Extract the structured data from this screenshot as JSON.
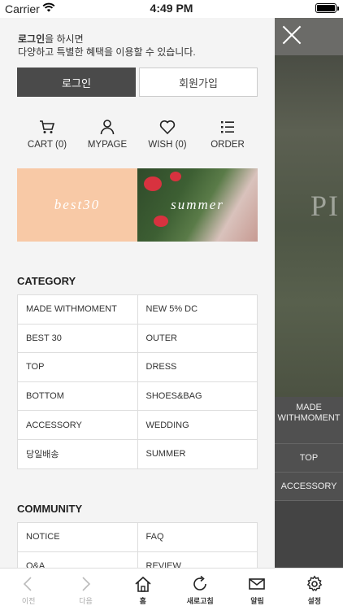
{
  "status_bar": {
    "carrier": "Carrier",
    "time": "4:49 PM"
  },
  "drawer": {
    "intro_bold": "로그인",
    "intro_rest": "을 하시면",
    "intro_line2": "다양하고 특별한 혜택을 이용할 수 있습니다.",
    "login_label": "로그인",
    "join_label": "회원가입",
    "quick_links": [
      {
        "label": "CART (0)",
        "icon": "cart-icon"
      },
      {
        "label": "MYPAGE",
        "icon": "person-icon"
      },
      {
        "label": "WISH (0)",
        "icon": "heart-icon"
      },
      {
        "label": "ORDER",
        "icon": "list-icon"
      }
    ],
    "banners": {
      "best": "best30",
      "summer": "summer"
    },
    "category_title": "CATEGORY",
    "categories": [
      "MADE WITHMOMENT",
      "NEW 5% DC",
      "BEST 30",
      "OUTER",
      "TOP",
      "DRESS",
      "BOTTOM",
      "SHOES&BAG",
      "ACCESSORY",
      "WEDDING",
      "당일배송",
      "SUMMER"
    ],
    "community_title": "COMMUNITY",
    "community": [
      "NOTICE",
      "FAQ",
      "Q&A",
      "REVIEW"
    ]
  },
  "backdrop": {
    "big_text": "PI",
    "menu": [
      "MADE WITHMOMENT",
      "TOP",
      "ACCESSORY"
    ]
  },
  "tabbar": [
    {
      "label": "이전",
      "icon": "back-arrow-icon",
      "enabled": false
    },
    {
      "label": "다음",
      "icon": "forward-arrow-icon",
      "enabled": false
    },
    {
      "label": "홈",
      "icon": "home-icon",
      "enabled": true
    },
    {
      "label": "새로고침",
      "icon": "refresh-icon",
      "enabled": true
    },
    {
      "label": "알림",
      "icon": "mail-icon",
      "enabled": true
    },
    {
      "label": "설정",
      "icon": "gear-icon",
      "enabled": true
    }
  ],
  "colors": {
    "login_button": "#4a4a4a",
    "best_banner": "#f8c9a6",
    "drawer_bg": "#f4f4f4"
  }
}
